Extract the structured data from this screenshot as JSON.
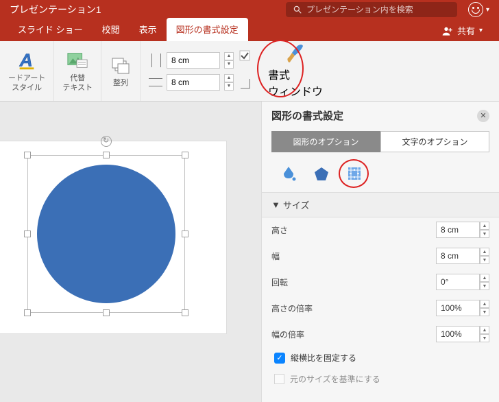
{
  "titlebar": {
    "title": "プレゼンテーション1",
    "search_placeholder": "プレゼンテーション内を検索"
  },
  "tabs": {
    "slideshow": "スライド ショー",
    "review": "校閲",
    "view": "表示",
    "shape_format": "図形の書式設定",
    "share": "共有"
  },
  "ribbon": {
    "wordart": "ードアート\nスタイル",
    "alttext": "代替\nテキスト",
    "arrange": "整列",
    "height_val": "8 cm",
    "width_val": "8 cm",
    "format_pane": "書式\nウィンドウ"
  },
  "pane": {
    "title": "図形の書式設定",
    "seg_shape": "図形のオプション",
    "seg_text": "文字のオプション",
    "section_size": "サイズ",
    "height_label": "高さ",
    "height_val": "8 cm",
    "width_label": "幅",
    "width_val": "8 cm",
    "rotation_label": "回転",
    "rotation_val": "0°",
    "scale_h_label": "高さの倍率",
    "scale_h_val": "100%",
    "scale_w_label": "幅の倍率",
    "scale_w_val": "100%",
    "lock_aspect": "縦横比を固定する",
    "relative_orig": "元のサイズを基準にする"
  }
}
